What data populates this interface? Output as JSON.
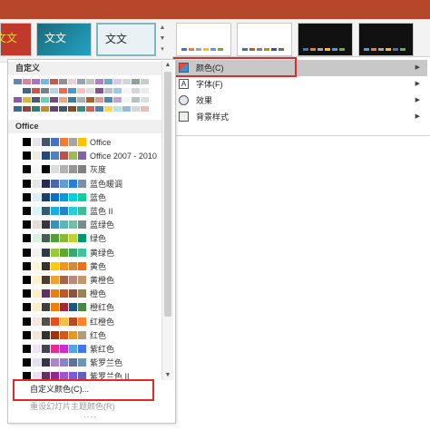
{
  "theme_gallery": {
    "thumbnails": [
      {
        "label": "文文",
        "bg": "#c0392b"
      },
      {
        "label": "文文",
        "bg": "#1f7f96"
      },
      {
        "label": "文文",
        "bg": "#e8f2f4"
      }
    ],
    "variants": [
      {
        "bg": "#ffffff",
        "strip": [
          "#4472c4",
          "#ed7d31",
          "#a5a5a5",
          "#ffc000",
          "#5b9bd5",
          "#70ad47"
        ]
      },
      {
        "bg": "#ffffff",
        "strip": [
          "#2e75b6",
          "#c55a11",
          "#7f7f7f",
          "#bf8f00",
          "#2f5597",
          "#548235"
        ]
      },
      {
        "bg": "#111111",
        "strip": [
          "#4472c4",
          "#ed7d31",
          "#a5a5a5",
          "#ffc000",
          "#5b9bd5",
          "#70ad47"
        ]
      },
      {
        "bg": "#111111",
        "strip": [
          "#5b9bd5",
          "#ed7d31",
          "#a5a5a5",
          "#ffc000",
          "#4472c4",
          "#70ad47"
        ]
      }
    ]
  },
  "submenu": {
    "items": [
      {
        "label": "颜色(C)",
        "icon": "color-palette-icon",
        "active": true
      },
      {
        "label": "字体(F)",
        "icon": "font-icon",
        "active": false
      },
      {
        "label": "效果",
        "icon": "effects-icon",
        "active": false
      },
      {
        "label": "背景样式",
        "icon": "background-style-icon",
        "active": false
      }
    ]
  },
  "panel": {
    "custom_header": "自定义",
    "office_header": "Office",
    "custom_label": "自定义颜色(C)...",
    "reset_label": "重设幻灯片主题颜色(R)"
  },
  "color_schemes": [
    {
      "label": "Office",
      "colors": [
        "#ffffff",
        "#000000",
        "#e7e6e6",
        "#44546a",
        "#4472c4",
        "#ed7d31",
        "#a5a5a5",
        "#ffc000"
      ]
    },
    {
      "label": "Office 2007 - 2010",
      "colors": [
        "#ffffff",
        "#000000",
        "#eeece1",
        "#1f497d",
        "#4f81bd",
        "#c0504d",
        "#9bbb59",
        "#8064a2"
      ]
    },
    {
      "label": "灰度",
      "colors": [
        "#ffffff",
        "#000000",
        "#f8f8f8",
        "#000000",
        "#dddddd",
        "#b2b2b2",
        "#969696",
        "#808080"
      ]
    },
    {
      "label": "蓝色暖调",
      "colors": [
        "#ffffff",
        "#000000",
        "#e7e6e6",
        "#242852",
        "#4a66ac",
        "#629dd1",
        "#297fd5",
        "#7f8fa9"
      ]
    },
    {
      "label": "蓝色",
      "colors": [
        "#ffffff",
        "#000000",
        "#dbeff9",
        "#17406d",
        "#0f6fc6",
        "#009dd9",
        "#0bd0d9",
        "#10cf9b"
      ]
    },
    {
      "label": "蓝色 II",
      "colors": [
        "#ffffff",
        "#000000",
        "#dbf5f9",
        "#335b74",
        "#1cade4",
        "#2683c6",
        "#27ced7",
        "#42ba97"
      ]
    },
    {
      "label": "蓝绿色",
      "colors": [
        "#ffffff",
        "#000000",
        "#e3ded1",
        "#373545",
        "#3494ba",
        "#58b6c0",
        "#75bda7",
        "#7a8c8e"
      ]
    },
    {
      "label": "绿色",
      "colors": [
        "#ffffff",
        "#000000",
        "#dbefe5",
        "#455f51",
        "#549e39",
        "#8ab833",
        "#c0cf3a",
        "#029676"
      ]
    },
    {
      "label": "黄绿色",
      "colors": [
        "#ffffff",
        "#000000",
        "#f2f2f2",
        "#2c3c43",
        "#99cb38",
        "#63a537",
        "#37a76f",
        "#44c1a3"
      ]
    },
    {
      "label": "黄色",
      "colors": [
        "#ffffff",
        "#000000",
        "#fffcd5",
        "#39302a",
        "#ffca08",
        "#f8931d",
        "#ce8d3e",
        "#ec7016"
      ]
    },
    {
      "label": "黄橙色",
      "colors": [
        "#ffffff",
        "#000000",
        "#fff1cc",
        "#4e3b30",
        "#f0a22e",
        "#a5644e",
        "#b58b80",
        "#c3986d"
      ]
    },
    {
      "label": "橙色",
      "colors": [
        "#ffffff",
        "#000000",
        "#fbeec9",
        "#632e62",
        "#e48312",
        "#bd582c",
        "#865640",
        "#9b8357"
      ]
    },
    {
      "label": "橙红色",
      "colors": [
        "#ffffff",
        "#000000",
        "#fbeec9",
        "#3f3f3f",
        "#f07f09",
        "#9f2936",
        "#1b587c",
        "#4e8542"
      ]
    },
    {
      "label": "红橙色",
      "colors": [
        "#ffffff",
        "#000000",
        "#f8e5e1",
        "#505046",
        "#e84c22",
        "#ffbd47",
        "#b64926",
        "#ff8427"
      ]
    },
    {
      "label": "红色",
      "colors": [
        "#ffffff",
        "#000000",
        "#f8e3d9",
        "#323232",
        "#a5300f",
        "#d55816",
        "#e19825",
        "#b19c7d"
      ]
    },
    {
      "label": "紫红色",
      "colors": [
        "#ffffff",
        "#000000",
        "#f1e3f2",
        "#454551",
        "#e32d91",
        "#c830cc",
        "#4ea6dc",
        "#4775e7"
      ]
    },
    {
      "label": "紫罗兰色",
      "colors": [
        "#ffffff",
        "#000000",
        "#e2e1ef",
        "#373545",
        "#ad84c6",
        "#8784c7",
        "#5d739a",
        "#6997af"
      ]
    },
    {
      "label": "紫罗兰色 II",
      "colors": [
        "#ffffff",
        "#000000",
        "#ebe2f0",
        "#632e62",
        "#92278f",
        "#9b57d3",
        "#755dd9",
        "#665eb8"
      ]
    }
  ],
  "custom_blurred_swatches": [
    [
      "#4b6fa8",
      "#d86b8c",
      "#9b59b6",
      "#5dade2",
      "#c0392b",
      "#7b7d7d",
      "#e8c3d2",
      "#85929e",
      "#b7b7b7",
      "#a569bd",
      "#5499c7",
      "#d7bde2",
      "#cacfd2",
      "#7f8c8d",
      "#bdc3c7"
    ],
    [
      "#ffffff",
      "#1b4f72",
      "#c0392b",
      "#5d6d7e",
      "#a9cce3",
      "#e74c3c",
      "#2e86c1",
      "#f5b7b1",
      "#d7dbdd",
      "#6c3483",
      "#aeb6bf",
      "#85c1e9",
      "#f2f3f4",
      "#cacfd2",
      "#e5e8e8"
    ],
    [
      "#7d3c98",
      "#d4ac0d",
      "#2e4053",
      "#48c9b0",
      "#5b2c6f",
      "#e59866",
      "#1f618d",
      "#95a5a6",
      "#a04000",
      "#d98880",
      "#2874a6",
      "#bb8fce",
      "#f0f3f4",
      "#aab7b8",
      "#d5d8dc"
    ],
    [
      "#1a5276",
      "#7b241c",
      "#0e6655",
      "#b9770e",
      "#4a235a",
      "#283747",
      "#6e2c00",
      "#117864",
      "#cb4335",
      "#2471a3",
      "#f4d03f",
      "#a3e4d7",
      "#7fb3d5",
      "#ccd1d1",
      "#e6b0aa"
    ]
  ]
}
